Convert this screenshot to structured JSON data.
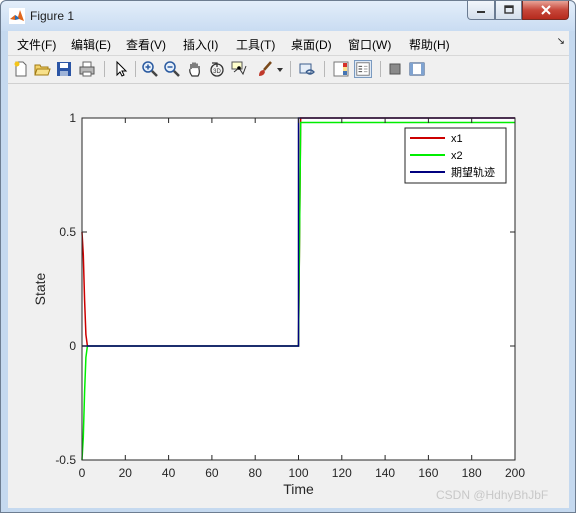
{
  "window": {
    "title": "Figure 1"
  },
  "menu": [
    {
      "id": "file",
      "label": "文件(F)"
    },
    {
      "id": "edit",
      "label": "编辑(E)"
    },
    {
      "id": "view",
      "label": "查看(V)"
    },
    {
      "id": "insert",
      "label": "插入(I)"
    },
    {
      "id": "tools",
      "label": "工具(T)"
    },
    {
      "id": "desktop",
      "label": "桌面(D)"
    },
    {
      "id": "window",
      "label": "窗口(W)"
    },
    {
      "id": "help",
      "label": "帮助(H)"
    }
  ],
  "toolbar": {
    "icons": [
      "new-figure-icon",
      "open-file-icon",
      "save-icon",
      "print-icon",
      "edit-plot-arrow-icon",
      "zoom-in-icon",
      "zoom-out-icon",
      "pan-hand-icon",
      "rotate-3d-icon",
      "data-cursor-icon",
      "brush-icon",
      "brush-dropdown-icon",
      "link-plot-icon",
      "insert-colorbar-icon",
      "insert-legend-icon",
      "hide-plot-tools-icon",
      "show-plot-tools-icon"
    ],
    "selected": "insert-legend-icon"
  },
  "chart_data": {
    "type": "line",
    "title": "",
    "xlabel": "Time",
    "ylabel": "State",
    "xlim": [
      0,
      200
    ],
    "ylim": [
      -0.5,
      1
    ],
    "xticks": [
      0,
      20,
      40,
      60,
      80,
      100,
      120,
      140,
      160,
      180,
      200
    ],
    "xtick_labels": [
      "0",
      "20",
      "40",
      "60",
      "80",
      "100",
      "120",
      "140",
      "160",
      "180",
      "200"
    ],
    "yticks": [
      -0.5,
      0,
      0.5,
      1
    ],
    "ytick_labels": [
      "-0.5",
      "0",
      "0.5",
      "1"
    ],
    "grid": false,
    "legend": "top-right",
    "series": [
      {
        "name": "x1",
        "color": "#cc0000",
        "x": [
          0,
          0.6,
          1.2,
          1.8,
          2.5,
          100,
          101,
          200
        ],
        "y": [
          0.5,
          0.4,
          0.2,
          0.05,
          0,
          0,
          1,
          1
        ]
      },
      {
        "name": "x2",
        "color": "#00ee00",
        "x": [
          0,
          0.6,
          1.2,
          1.8,
          2.5,
          100,
          101,
          200
        ],
        "y": [
          -0.5,
          -0.4,
          -0.2,
          -0.05,
          0,
          0,
          0.98,
          0.98
        ]
      },
      {
        "name": "期望轨迹",
        "color": "#00007f",
        "x": [
          0,
          100,
          100,
          200
        ],
        "y": [
          0,
          0,
          1,
          1
        ]
      }
    ]
  },
  "watermark": "CSDN @HdhyBhJbF"
}
